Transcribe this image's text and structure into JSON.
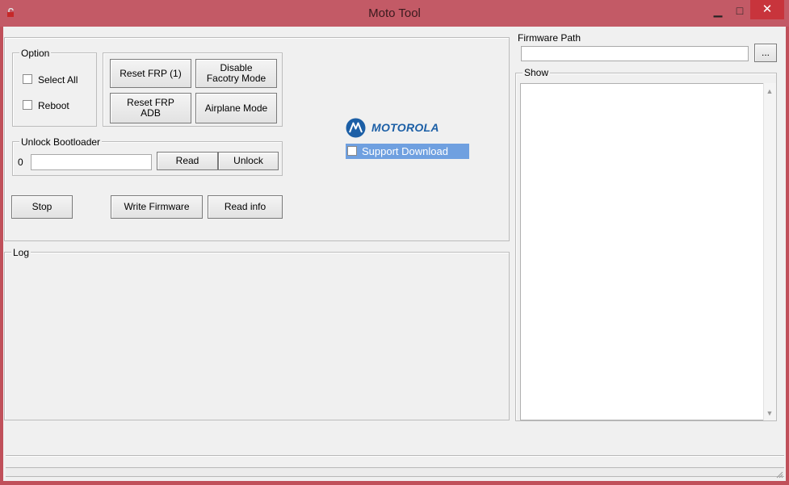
{
  "window": {
    "title": "Moto Tool",
    "minimize_glyph": "▁",
    "maximize_glyph": "□",
    "close_glyph": "✕",
    "app_icon": "lock-icon"
  },
  "option_group": {
    "label": "Option",
    "select_all": "Select All",
    "reboot": "Reboot"
  },
  "actions": {
    "reset_frp": "Reset FRP (1)",
    "disable_factory_l1": "Disable",
    "disable_factory_l2": "Facotry Mode",
    "reset_frp_adb_l1": "Reset FRP",
    "reset_frp_adb_l2": "ADB",
    "airplane_mode": "Airplane Mode"
  },
  "unlock_group": {
    "label": "Unlock Bootloader",
    "count": "0",
    "input_value": "",
    "read": "Read",
    "unlock": "Unlock"
  },
  "bottom_buttons": {
    "stop": "Stop",
    "write_firmware": "Write Firmware",
    "read_info": "Read info"
  },
  "brand": {
    "logo_text": "MOTOROLA",
    "support_download": "Support Download",
    "brand_color": "#1c5fa6",
    "highlight_color": "#6fa0e0"
  },
  "log_group": {
    "label": "Log"
  },
  "firmware": {
    "label": "Firmware Path",
    "value": "",
    "browse": "..."
  },
  "show_group": {
    "label": "Show"
  },
  "colors": {
    "titlebar": "#c35a66",
    "close": "#c8343c",
    "surface": "#f0f0f0"
  }
}
